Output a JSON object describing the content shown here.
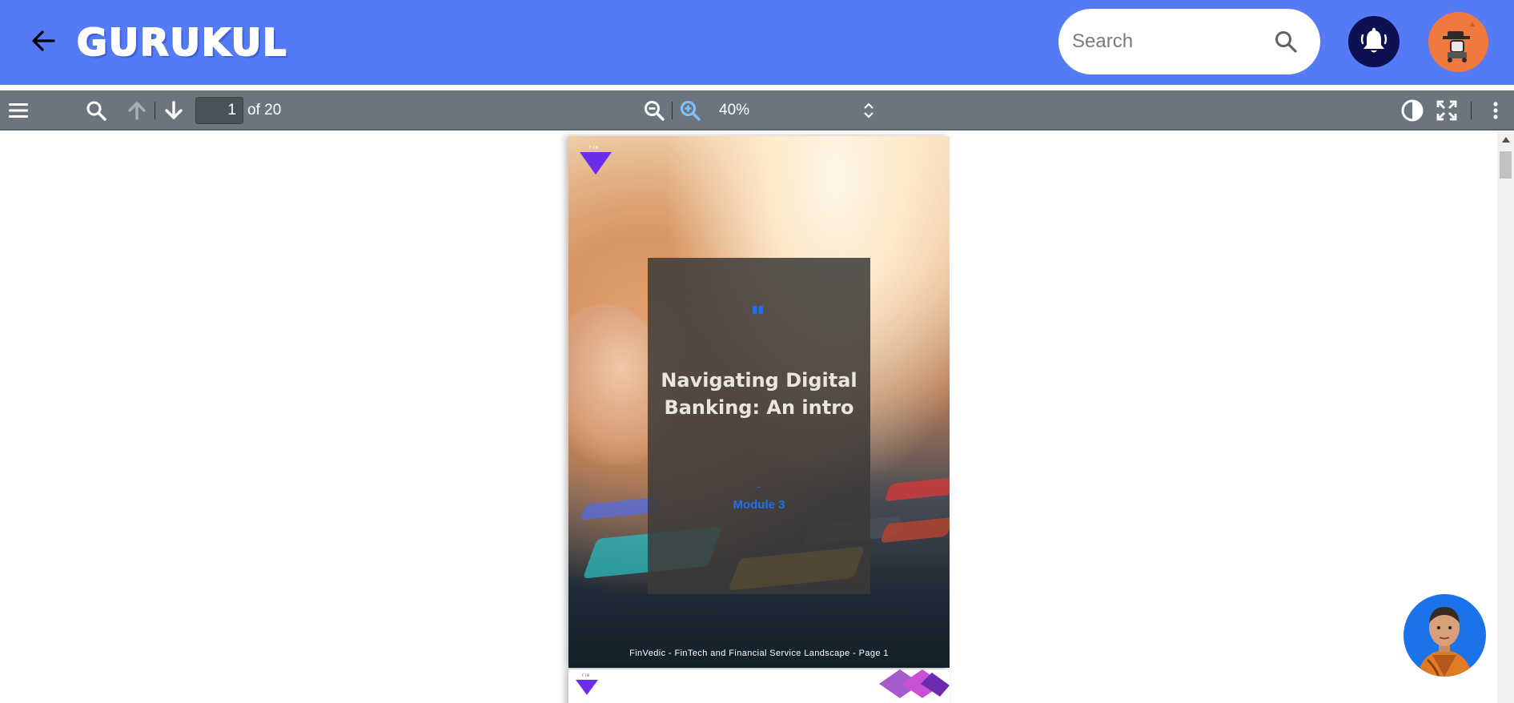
{
  "header": {
    "logo_text": "GURUKUL",
    "search_placeholder": "Search",
    "back_icon": "arrow-left-icon",
    "search_icon": "search-icon",
    "bell_icon": "bell-icon",
    "avatar_icon": "robot-avatar-icon",
    "colors": {
      "bar": "#557af5",
      "bell_bg": "#0d1152",
      "avatar_bg": "#f0793f"
    }
  },
  "toolbar": {
    "current_page": "1",
    "page_of": "of 20",
    "zoom": "40%",
    "icons": [
      "sidebar-toggle-icon",
      "find-icon",
      "previous-page-icon",
      "next-page-icon",
      "zoom-out-icon",
      "zoom-in-icon",
      "zoom-select-arrows-icon",
      "contrast-icon",
      "fullscreen-icon",
      "more-options-icon"
    ],
    "colors": {
      "bar": "#6c757d"
    }
  },
  "document": {
    "title": "Navigating Digital Banking: An intro",
    "module": "Module 3",
    "footer": "FinVedic - FinTech and Financial Service Landscape - Page 1",
    "logo_letters": "F I N",
    "colors": {
      "accent_blue": "#1f6feb",
      "logo_purple": "#6a2ee8"
    }
  },
  "assistant": {
    "icon": "monk-assistant-avatar"
  }
}
